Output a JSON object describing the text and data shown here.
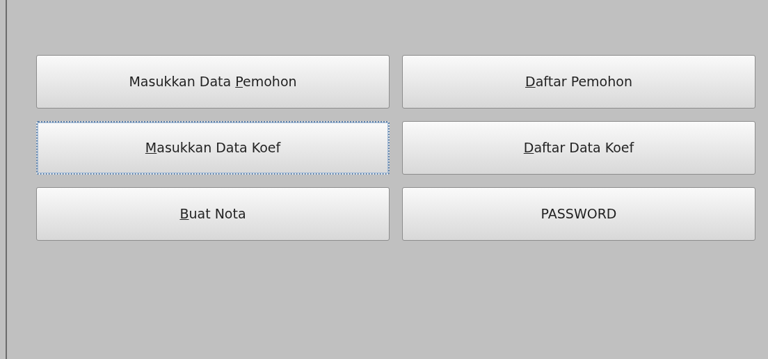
{
  "buttons": [
    {
      "label_parts": [
        {
          "text": "Masukkan Data ",
          "underlined": false
        },
        {
          "text": "P",
          "underlined": true
        },
        {
          "text": "emohon",
          "underlined": false
        }
      ],
      "focused": false
    },
    {
      "label_parts": [
        {
          "text": "D",
          "underlined": true
        },
        {
          "text": "aftar Pemohon",
          "underlined": false
        }
      ],
      "focused": false
    },
    {
      "label_parts": [
        {
          "text": "M",
          "underlined": true
        },
        {
          "text": "asukkan Data Koef",
          "underlined": false
        }
      ],
      "focused": true
    },
    {
      "label_parts": [
        {
          "text": "D",
          "underlined": true
        },
        {
          "text": "aftar Data Koef",
          "underlined": false
        }
      ],
      "focused": false
    },
    {
      "label_parts": [
        {
          "text": "B",
          "underlined": true
        },
        {
          "text": "uat Nota",
          "underlined": false
        }
      ],
      "focused": false
    },
    {
      "label_parts": [
        {
          "text": "PASSWORD",
          "underlined": false
        }
      ],
      "focused": false
    }
  ]
}
